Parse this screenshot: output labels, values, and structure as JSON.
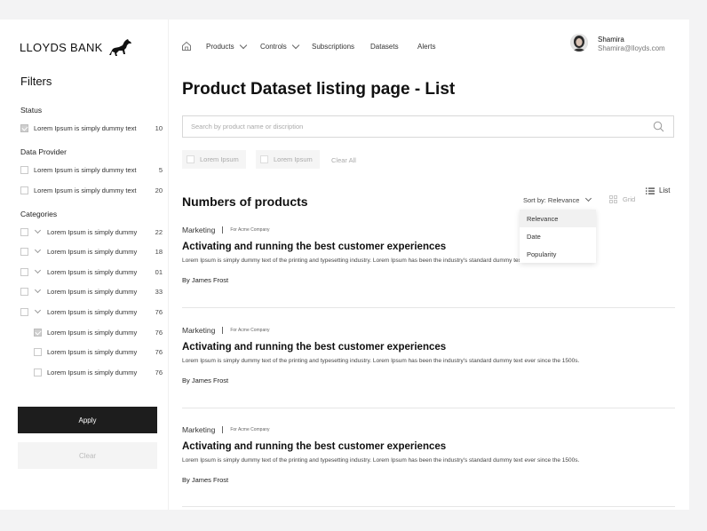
{
  "brand": {
    "name": "LLOYDS BANK"
  },
  "sidebar": {
    "title": "Filters",
    "status": {
      "title": "Status",
      "items": [
        {
          "label": "Lorem Ipsum is simply dummy text",
          "count": "10",
          "checked": true
        }
      ]
    },
    "data_provider": {
      "title": "Data Provider",
      "items": [
        {
          "label": "Lorem Ipsum is simply dummy text",
          "count": "5"
        },
        {
          "label": "Lorem Ipsum is simply dummy text",
          "count": "20"
        }
      ]
    },
    "categories": {
      "title": "Categories",
      "items": [
        {
          "label": "Lorem Ipsum is simply dummy",
          "count": "22"
        },
        {
          "label": "Lorem Ipsum is simply dummy",
          "count": "18"
        },
        {
          "label": "Lorem Ipsum is simply dummy",
          "count": "01"
        },
        {
          "label": "Lorem Ipsum is simply dummy",
          "count": "33"
        },
        {
          "label": "Lorem Ipsum is simply dummy",
          "count": "76"
        }
      ],
      "sub_items": [
        {
          "label": "Lorem Ipsum is simply dummy",
          "count": "76",
          "checked": true
        },
        {
          "label": "Lorem Ipsum is simply dummy",
          "count": "76"
        },
        {
          "label": "Lorem Ipsum is simply dummy",
          "count": "76"
        }
      ]
    },
    "apply_label": "Apply",
    "clear_label": "Clear"
  },
  "nav": {
    "items": [
      "Products",
      "Controls",
      "Subscriptions",
      "Datasets",
      "Alerts"
    ],
    "user": {
      "name": "Shamira",
      "email": "Shamira@lloyds.com"
    }
  },
  "main": {
    "title": "Product Dataset listing page - List",
    "search_placeholder": "Search by product name or discription",
    "chips": [
      "Lorem Ipsum",
      "Lorem Ipsum"
    ],
    "clear_all": "Clear All",
    "count_title": "Numbers of products",
    "sort_label": "Sort by: Relevance",
    "sort_options": [
      "Relevance",
      "Date",
      "Popularity"
    ],
    "grid_label": "Grid",
    "list_label": "List",
    "products": [
      {
        "category": "Marketing",
        "company": "For Acme Company",
        "title": "Activating and running the best customer experiences",
        "desc": "Lorem Ipsum is simply dummy text of the printing and typesetting industry. Lorem Ipsum has been the industry's standard dummy text ever since the 1500s.",
        "author": "By James Frost"
      },
      {
        "category": "Marketing",
        "company": "For Acme Company",
        "title": "Activating and running the best customer experiences",
        "desc": "Lorem Ipsum is simply dummy text of the printing and typesetting industry. Lorem Ipsum has been the industry's standard dummy text ever since the 1500s.",
        "author": "By James Frost"
      },
      {
        "category": "Marketing",
        "company": "For Acme Company",
        "title": "Activating and running the best customer experiences",
        "desc": "Lorem Ipsum is simply dummy text of the printing and typesetting industry. Lorem Ipsum has been the industry's standard dummy text ever since the 1500s.",
        "author": "By James Frost"
      }
    ]
  }
}
